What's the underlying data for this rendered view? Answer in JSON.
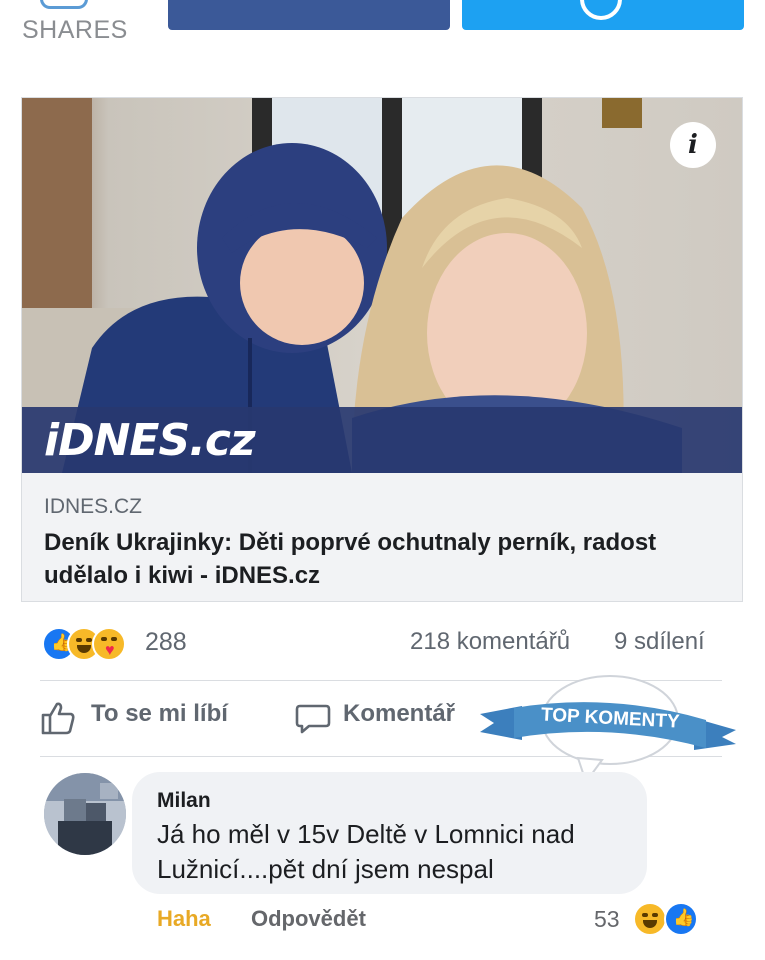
{
  "share_bar": {
    "shares_label": "SHARES",
    "facebook_color": "#3b5998",
    "twitter_color": "#1da1f2"
  },
  "link_card": {
    "image_brand": "iDNES.cz",
    "domain": "IDNES.CZ",
    "headline": "Deník Ukrajinky: Děti poprvé ochutnaly perník, radost udělalo i kiwi - iDNES.cz",
    "info_icon": "i"
  },
  "reactions": {
    "icons": [
      "like-icon",
      "haha-icon",
      "care-icon"
    ],
    "count": "288",
    "comments": "218 komentářů",
    "shares": "9 sdílení"
  },
  "actions": {
    "like_label": "To se mi líbí",
    "comment_label": "Komentář"
  },
  "top_comments_badge": "TOP KOMENTY",
  "comment": {
    "author": "Milan",
    "text": "Já ho měl v 15v Deltě v Lomnici nad Lužnicí....pět dní jsem nespal",
    "reaction_label": "Haha",
    "reply_label": "Odpovědět",
    "reaction_count": "53",
    "reaction_icons": [
      "haha-icon",
      "like-icon"
    ]
  },
  "colors": {
    "accent_blue": "#1877f2",
    "ribbon_blue": "#4a90c8",
    "haha_yellow": "#f7b928",
    "muted_text": "#606770"
  }
}
